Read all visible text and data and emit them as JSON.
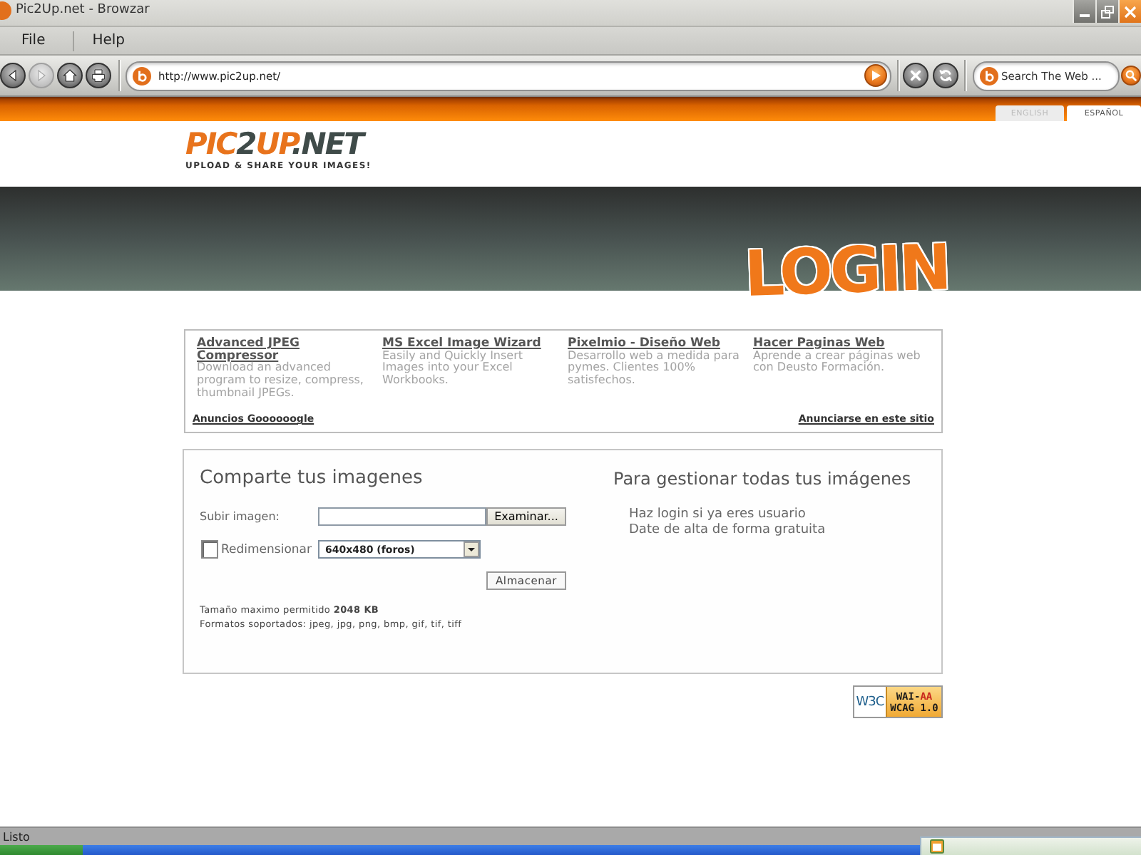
{
  "window": {
    "title": "Pic2Up.net - Browzar"
  },
  "menu": [
    {
      "label": "File"
    },
    {
      "label": "Help"
    }
  ],
  "toolbar": {
    "nav_buttons": [
      {
        "kind": "back",
        "disabled": false
      },
      {
        "kind": "forward",
        "disabled": true
      },
      {
        "kind": "home",
        "disabled": false
      },
      {
        "kind": "print",
        "disabled": false
      }
    ],
    "address": {
      "value": "http://www.pic2up.net/"
    },
    "page_buttons": [
      {
        "kind": "stop"
      },
      {
        "kind": "refresh"
      }
    ],
    "search": {
      "placeholder": "Search The Web ..."
    }
  },
  "language_tabs": [
    {
      "label": "ENGLISH",
      "selected": false
    },
    {
      "label": "ESPAÑOL",
      "selected": true
    }
  ],
  "logo": {
    "parts": [
      {
        "text": "PIC",
        "color": "#e8731c"
      },
      {
        "text": "2",
        "color": "#3f4b49"
      },
      {
        "text": "UP",
        "color": "#e8731c"
      },
      {
        "text": ".NET",
        "color": "#3f4b49"
      }
    ],
    "tagline": "UPLOAD & SHARE YOUR IMAGES!"
  },
  "banner": {
    "title": "LOGIN"
  },
  "ads": {
    "items": [
      {
        "title": "Advanced JPEG Compressor",
        "text": "Download an advanced program to resize, compress, thumbnail JPEGs."
      },
      {
        "title": "MS Excel Image Wizard",
        "text": "Easily and Quickly Insert Images into your Excel Workbooks."
      },
      {
        "title": "Pixelmio - Diseño Web",
        "text": "Desarrollo web a medida para pymes. Clientes 100% satisfechos."
      },
      {
        "title": "Hacer Paginas Web",
        "text": "Aprende a crear páginas web con Deusto Formación."
      }
    ],
    "footer_left": "Anuncios Goooooogle",
    "footer_right": "Anunciarse en este sitio"
  },
  "upload": {
    "heading": "Comparte tus imagenes",
    "file_label": "Subir imagen:",
    "browse_button": "Examinar...",
    "resize": {
      "label": "Redimensionar",
      "checked": false
    },
    "size": "640x480 (foros)",
    "submit": "Almacenar",
    "notes": [
      "Tamaño maximo permitido **2048 KB**",
      "Formatos soportados: jpeg, jpg, png, bmp, gif, tif, tiff"
    ]
  },
  "account": {
    "heading": "Para gestionar todas tus imágenes",
    "links": [
      "Haz login si ya eres usuario",
      "Date de alta de forma gratuita"
    ]
  },
  "badge": {
    "logo": "W3C",
    "program": "WAI-",
    "grade": "AA",
    "standard": "WCAG 1.0"
  },
  "status_bar": {
    "text": "Listo"
  }
}
